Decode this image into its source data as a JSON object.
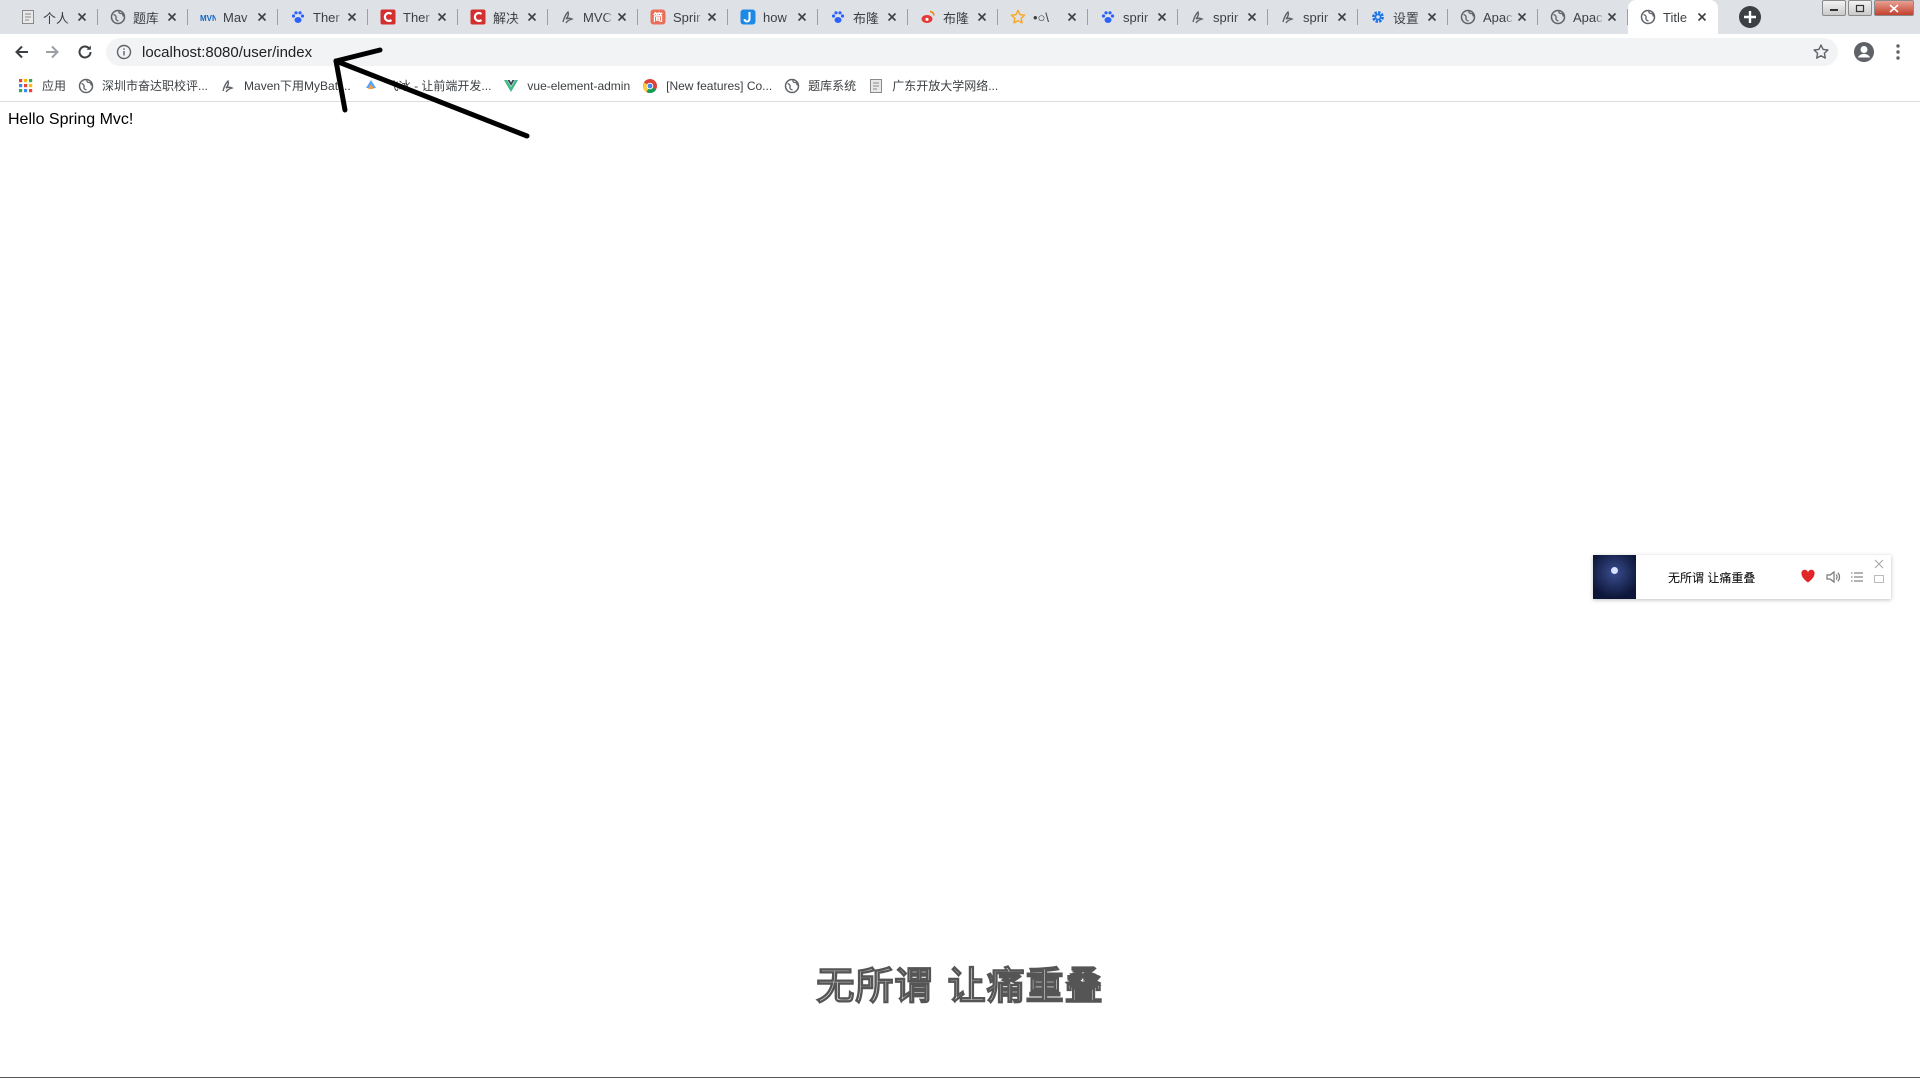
{
  "tabs": [
    {
      "label": "个人",
      "favicon": "document-icon",
      "color": "#9e9e9e"
    },
    {
      "label": "题库",
      "favicon": "globe-icon",
      "color": "#5f6368"
    },
    {
      "label": "Mav",
      "favicon": "mvn-icon",
      "color": "#1565c0"
    },
    {
      "label": "Ther",
      "favicon": "paw-icon",
      "color": "#2962ff"
    },
    {
      "label": "Ther",
      "favicon": "csdn-icon",
      "color": "#d32f2f"
    },
    {
      "label": "解决",
      "favicon": "csdn-icon",
      "color": "#d32f2f"
    },
    {
      "label": "MVC",
      "favicon": "brush-icon",
      "color": "#5f6368"
    },
    {
      "label": "Sprir",
      "favicon": "jianshu-icon",
      "color": "#ea6f5a"
    },
    {
      "label": "how",
      "favicon": "j-icon",
      "color": "#1e88e5"
    },
    {
      "label": "布隆",
      "favicon": "paw-icon",
      "color": "#2962ff"
    },
    {
      "label": "布隆",
      "favicon": "weibo-icon",
      "color": "#e53935"
    },
    {
      "label": "•○\\",
      "favicon": "star-icon",
      "color": "#f9a825"
    },
    {
      "label": "sprir",
      "favicon": "paw-icon",
      "color": "#2962ff"
    },
    {
      "label": "sprir",
      "favicon": "brush-icon",
      "color": "#5f6368"
    },
    {
      "label": "sprir",
      "favicon": "brush-icon",
      "color": "#5f6368"
    },
    {
      "label": "设置",
      "favicon": "gear-icon",
      "color": "#1a73e8"
    },
    {
      "label": "Apac",
      "favicon": "globe-icon",
      "color": "#5f6368"
    },
    {
      "label": "Apac",
      "favicon": "globe-icon",
      "color": "#5f6368"
    },
    {
      "label": "Title",
      "favicon": "globe-icon",
      "color": "#5f6368",
      "active": true
    }
  ],
  "omnibox": {
    "url": "localhost:8080/user/index"
  },
  "bookmarks": [
    {
      "label": "应用",
      "icon": "apps-grid-icon"
    },
    {
      "label": "深圳市奋达职校评...",
      "icon": "globe-icon"
    },
    {
      "label": "Maven下用MyBati...",
      "icon": "brush-icon"
    },
    {
      "label": "飞冰 - 让前端开发...",
      "icon": "ice-icon"
    },
    {
      "label": "vue-element-admin",
      "icon": "vue-icon"
    },
    {
      "label": "[New features] Co...",
      "icon": "chrome-icon"
    },
    {
      "label": "题库系统",
      "icon": "globe-icon"
    },
    {
      "label": "广东开放大学网络...",
      "icon": "document-icon"
    }
  ],
  "page": {
    "heading": "Hello Spring Mvc!"
  },
  "music_widget": {
    "title": "无所谓 让痛重叠",
    "heart_color": "#e0262b"
  },
  "lyrics": {
    "line": "无所谓 让痛重叠"
  }
}
